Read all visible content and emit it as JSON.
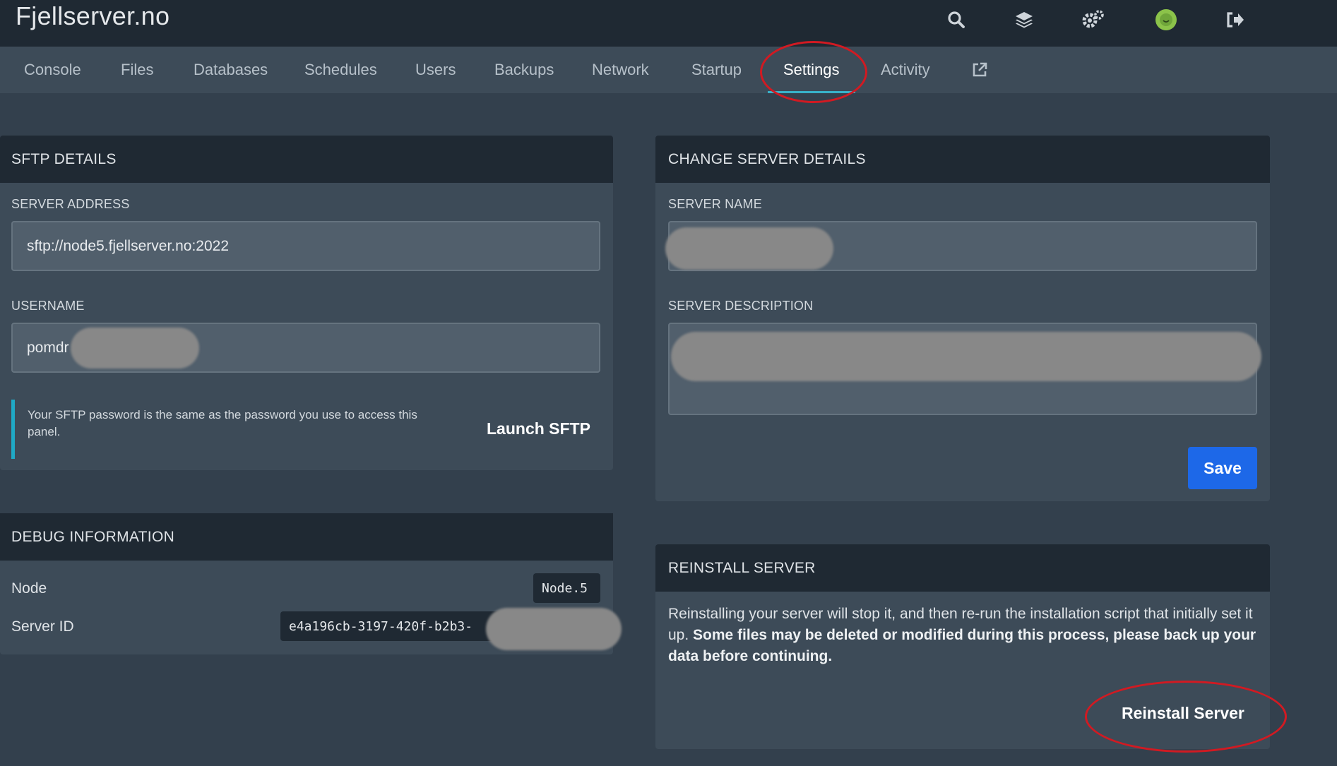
{
  "header": {
    "brand": "Fjellserver.no",
    "icons": [
      "search-icon",
      "layers-icon",
      "settings-icon",
      "avatar",
      "logout-icon"
    ]
  },
  "tabs": [
    {
      "label": "Console"
    },
    {
      "label": "Files"
    },
    {
      "label": "Databases"
    },
    {
      "label": "Schedules"
    },
    {
      "label": "Users"
    },
    {
      "label": "Backups"
    },
    {
      "label": "Network"
    },
    {
      "label": "Startup"
    },
    {
      "label": "Settings",
      "active": true
    },
    {
      "label": "Activity"
    }
  ],
  "sftp": {
    "title": "SFTP DETAILS",
    "address_label": "SERVER ADDRESS",
    "address_value": "sftp://node5.fjellserver.no:2022",
    "username_label": "USERNAME",
    "username_value": "pomdr",
    "note": "Your SFTP password is the same as the password you use to access this panel.",
    "launch_label": "Launch SFTP"
  },
  "change": {
    "title": "CHANGE SERVER DETAILS",
    "name_label": "SERVER NAME",
    "description_label": "SERVER DESCRIPTION",
    "save_label": "Save"
  },
  "debug": {
    "title": "DEBUG INFORMATION",
    "node_label": "Node",
    "node_value": "Node.5",
    "server_id_label": "Server ID",
    "server_id_value": "e4a196cb-3197-420f-b2b3-"
  },
  "reinstall": {
    "title": "REINSTALL SERVER",
    "text_plain": "Reinstalling your server will stop it, and then re-run the installation script that initially set it up. ",
    "text_bold": "Some files may be deleted or modified during this process, please back up your data before continuing.",
    "button_label": "Reinstall Server"
  },
  "colors": {
    "accent_blue": "#1d68e8",
    "tab_underline": "#38b2c9",
    "annotation_red": "#d11a22"
  }
}
